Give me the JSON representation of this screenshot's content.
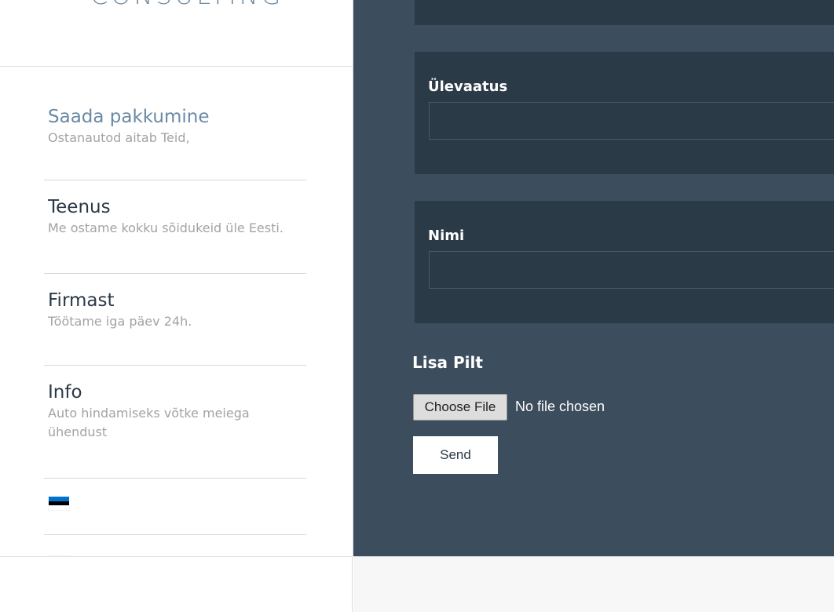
{
  "logo": {
    "text": "CONSULTING"
  },
  "nav": {
    "items": [
      {
        "title": "Saada pakkumine",
        "subtitle": "Ostanautod aitab Teid,",
        "active": true
      },
      {
        "title": "Teenus",
        "subtitle": "Me ostame kokku sõidukeid üle Eesti."
      },
      {
        "title": "Firmast",
        "subtitle": "Töötame iga päev 24h."
      },
      {
        "title": "Info",
        "subtitle": "Auto hindamiseks võtke meiega ühendust"
      }
    ],
    "languages": [
      {
        "icon": "estonia-flag-icon",
        "colors": [
          "#0072ce",
          "#000000",
          "#ffffff"
        ]
      },
      {
        "icon": "russia-flag-icon",
        "colors": [
          "#ffffff",
          "#0039a6",
          "#d52b1e"
        ]
      }
    ]
  },
  "form": {
    "fields": [
      {
        "label": "Ülevaatus",
        "value": ""
      },
      {
        "label": "Nimi",
        "value": ""
      }
    ],
    "upload": {
      "label": "Lisa Pilt",
      "button": "Choose File",
      "status": "No file chosen"
    },
    "submit": "Send"
  },
  "colors": {
    "panel": "#3c4d5d",
    "card": "#2b3a47",
    "accent": "#6a8aa5",
    "text_dark": "#2b3947",
    "text_muted": "#a3a3a3"
  }
}
